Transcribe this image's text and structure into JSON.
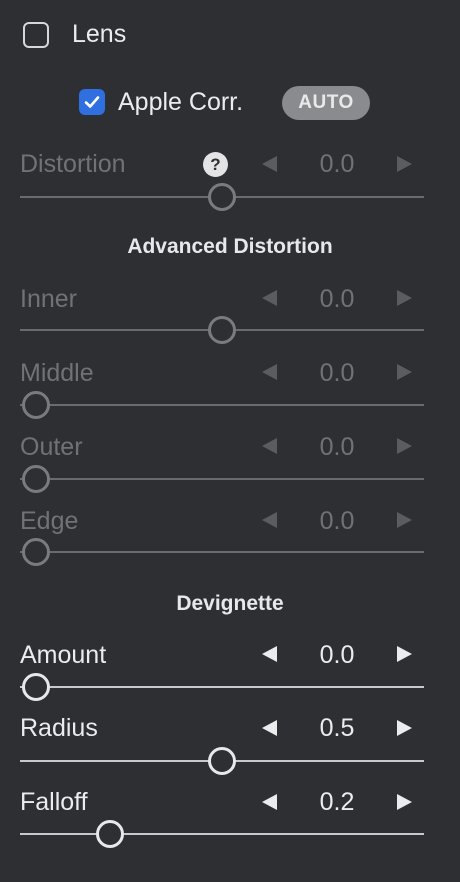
{
  "lens": {
    "label": "Lens",
    "checked": false
  },
  "apple_corr": {
    "label": "Apple Corr.",
    "checked": true,
    "auto_label": "AUTO"
  },
  "help_glyph": "?",
  "distortion": {
    "label": "Distortion",
    "value": "0.0",
    "enabled": false,
    "level": 0.5
  },
  "advanced": {
    "title": "Advanced Distortion",
    "inner": {
      "label": "Inner",
      "value": "0.0",
      "enabled": false,
      "level": 0.5
    },
    "middle": {
      "label": "Middle",
      "value": "0.0",
      "enabled": false,
      "level": 0.0
    },
    "outer": {
      "label": "Outer",
      "value": "0.0",
      "enabled": false,
      "level": 0.0
    },
    "edge": {
      "label": "Edge",
      "value": "0.0",
      "enabled": false,
      "level": 0.0
    }
  },
  "devignette": {
    "title": "Devignette",
    "amount": {
      "label": "Amount",
      "value": "0.0",
      "enabled": true,
      "level": 0.0
    },
    "radius": {
      "label": "Radius",
      "value": "0.5",
      "enabled": true,
      "level": 0.5
    },
    "falloff": {
      "label": "Falloff",
      "value": "0.2",
      "enabled": true,
      "level": 0.2
    }
  },
  "colors": {
    "background": "#2e2f33",
    "accent": "#2f6fe0",
    "auto_button": "#8a8b8f"
  },
  "icons": {
    "decrement": "triangle-left-icon",
    "increment": "triangle-right-icon",
    "help": "question-circle-icon",
    "check": "checkmark-icon"
  }
}
